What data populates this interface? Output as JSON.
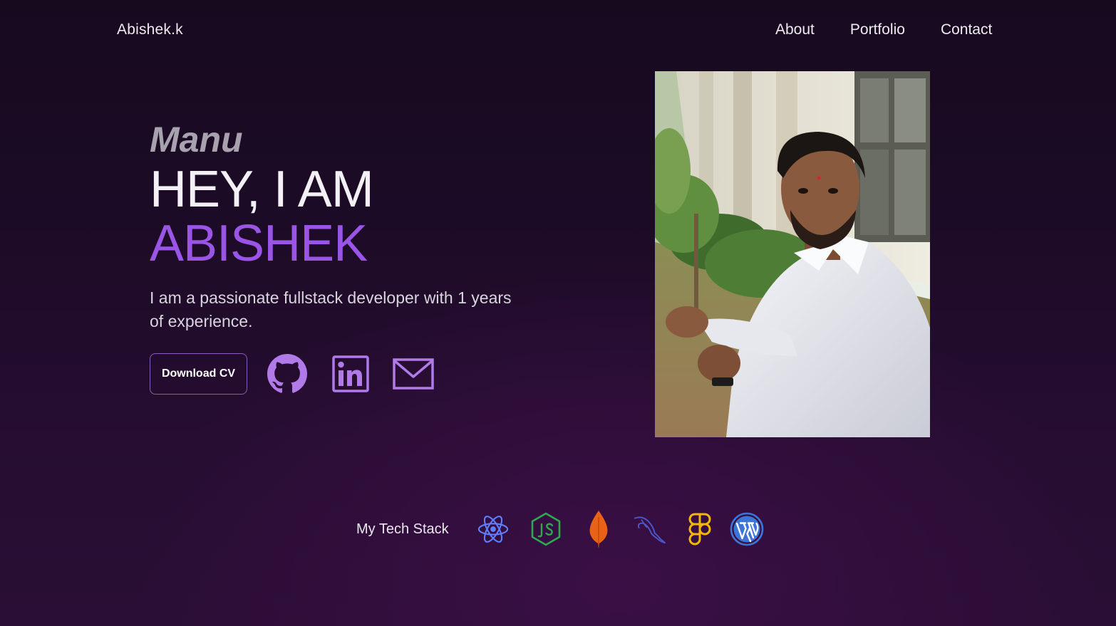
{
  "nav": {
    "brand": "Abishek.k",
    "links": [
      "About",
      "Portfolio",
      "Contact"
    ]
  },
  "hero": {
    "nickname": "Manu",
    "greeting": "HEY, I AM",
    "name": "ABISHEK",
    "bio": "I am a passionate fullstack developer with 1 years of experience.",
    "cv_button": "Download CV"
  },
  "social_icons": [
    "github-icon",
    "linkedin-icon",
    "mail-icon"
  ],
  "tech_stack": {
    "label": "My Tech Stack",
    "icons": [
      "react-icon",
      "nodejs-icon",
      "mongodb-icon",
      "mysql-icon",
      "figma-icon",
      "wordpress-icon"
    ]
  },
  "colors": {
    "accent": "#9b55e6",
    "icon_purple": "#b07ae8",
    "background_top": "#170a1f",
    "background_bottom": "#2a0e35"
  }
}
